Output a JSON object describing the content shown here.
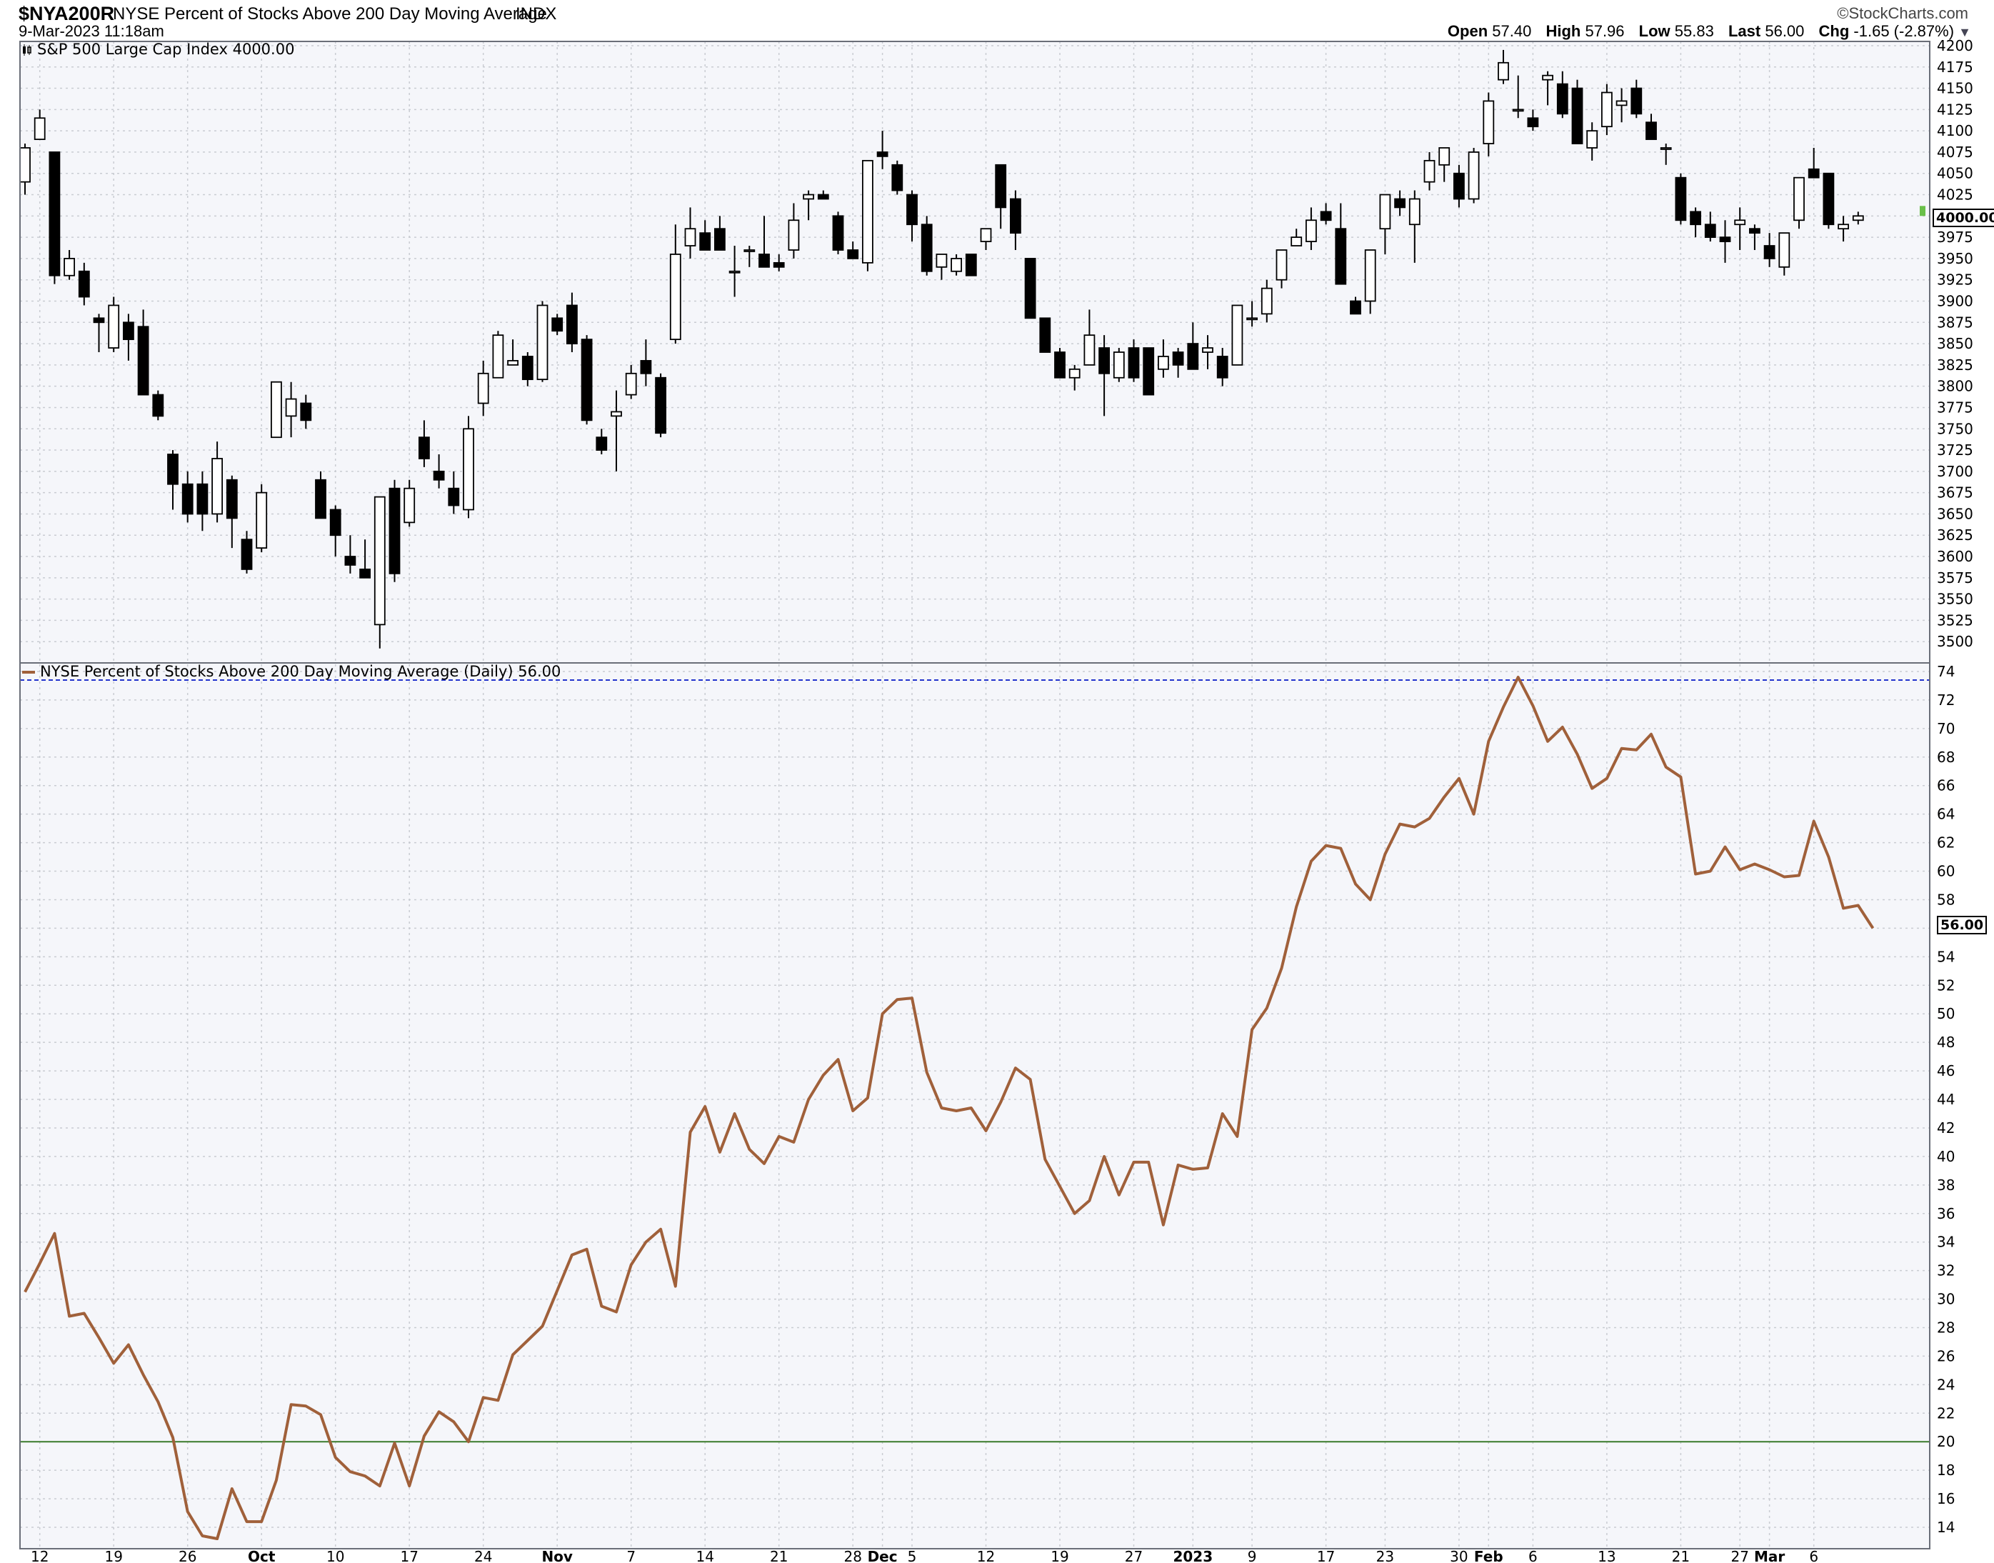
{
  "header": {
    "symbol": "$NYA200R",
    "description": "NYSE Percent of Stocks Above 200 Day Moving Average",
    "exchange": "INDX",
    "date": "9-Mar-2023 11:18am",
    "brand": "©StockCharts.com",
    "stats": [
      {
        "label": "Open",
        "value": "57.40"
      },
      {
        "label": "High",
        "value": "57.96"
      },
      {
        "label": "Low",
        "value": "55.83"
      },
      {
        "label": "Last",
        "value": "56.00"
      },
      {
        "label": "Chg",
        "value": "-1.65 (-2.87%)"
      }
    ],
    "dropdown_icon": "triangle-down-icon"
  },
  "colors": {
    "candle_up": "#ffffff",
    "candle_down": "#000000",
    "line": "#a0603a",
    "reference_line": "#3a7a2a",
    "dashed_line": "#2233cc",
    "grid": "#c9ccd2",
    "background": "#f5f6fa"
  },
  "chart_data": [
    {
      "type": "candlestick",
      "title": "S&P 500 Large Cap Index 4000.00",
      "ylim": [
        3475,
        4205
      ],
      "yticks": [
        3500,
        3525,
        3550,
        3575,
        3600,
        3625,
        3650,
        3675,
        3700,
        3725,
        3750,
        3775,
        3800,
        3825,
        3850,
        3875,
        3900,
        3925,
        3950,
        3975,
        4000,
        4025,
        4050,
        4075,
        4100,
        4125,
        4150,
        4175,
        4200
      ],
      "last_label": "4000.00",
      "ohlc": [
        [
          4040,
          4085,
          4025,
          4080
        ],
        [
          4090,
          4125,
          4090,
          4115
        ],
        [
          4075,
          4075,
          3920,
          3930
        ],
        [
          3930,
          3960,
          3925,
          3950
        ],
        [
          3935,
          3945,
          3895,
          3905
        ],
        [
          3880,
          3885,
          3840,
          3875
        ],
        [
          3845,
          3905,
          3840,
          3895
        ],
        [
          3875,
          3885,
          3830,
          3855
        ],
        [
          3870,
          3890,
          3790,
          3790
        ],
        [
          3790,
          3795,
          3760,
          3765
        ],
        [
          3720,
          3725,
          3655,
          3685
        ],
        [
          3685,
          3700,
          3640,
          3650
        ],
        [
          3685,
          3700,
          3630,
          3650
        ],
        [
          3650,
          3735,
          3640,
          3715
        ],
        [
          3690,
          3695,
          3610,
          3645
        ],
        [
          3620,
          3630,
          3580,
          3585
        ],
        [
          3610,
          3685,
          3605,
          3675
        ],
        [
          3740,
          3800,
          3740,
          3805
        ],
        [
          3765,
          3805,
          3740,
          3785
        ],
        [
          3780,
          3790,
          3750,
          3760
        ],
        [
          3690,
          3700,
          3645,
          3645
        ],
        [
          3655,
          3660,
          3600,
          3625
        ],
        [
          3600,
          3625,
          3580,
          3590
        ],
        [
          3585,
          3620,
          3575,
          3575
        ],
        [
          3520,
          3665,
          3492,
          3670
        ],
        [
          3680,
          3690,
          3570,
          3580
        ],
        [
          3640,
          3690,
          3635,
          3680
        ],
        [
          3740,
          3760,
          3705,
          3715
        ],
        [
          3700,
          3720,
          3680,
          3690
        ],
        [
          3680,
          3700,
          3650,
          3660
        ],
        [
          3655,
          3765,
          3645,
          3750
        ],
        [
          3780,
          3830,
          3765,
          3815
        ],
        [
          3810,
          3865,
          3810,
          3860
        ],
        [
          3825,
          3855,
          3825,
          3830
        ],
        [
          3835,
          3840,
          3800,
          3808
        ],
        [
          3808,
          3900,
          3805,
          3895
        ],
        [
          3880,
          3885,
          3860,
          3865
        ],
        [
          3895,
          3910,
          3840,
          3850
        ],
        [
          3855,
          3860,
          3755,
          3760
        ],
        [
          3740,
          3750,
          3720,
          3725
        ],
        [
          3765,
          3795,
          3700,
          3770
        ],
        [
          3790,
          3825,
          3785,
          3815
        ],
        [
          3830,
          3855,
          3800,
          3815
        ],
        [
          3810,
          3815,
          3740,
          3745
        ],
        [
          3855,
          3990,
          3850,
          3955
        ],
        [
          3965,
          4010,
          3950,
          3985
        ],
        [
          3980,
          3995,
          3960,
          3960
        ],
        [
          3985,
          4000,
          3960,
          3960
        ],
        [
          3935,
          3965,
          3905,
          3935
        ],
        [
          3960,
          3965,
          3940,
          3960
        ],
        [
          3955,
          4000,
          3945,
          3940
        ],
        [
          3945,
          3955,
          3935,
          3940
        ],
        [
          3960,
          4015,
          3950,
          3995
        ],
        [
          4020,
          4030,
          3995,
          4025
        ],
        [
          4025,
          4030,
          4025,
          4020
        ],
        [
          4000,
          4005,
          3955,
          3960
        ],
        [
          3960,
          3970,
          3950,
          3950
        ],
        [
          3945,
          4065,
          3935,
          4065
        ],
        [
          4075,
          4100,
          4055,
          4070
        ],
        [
          4060,
          4065,
          4025,
          4030
        ],
        [
          4025,
          4030,
          3970,
          3990
        ],
        [
          3990,
          4000,
          3930,
          3935
        ],
        [
          3940,
          3945,
          3925,
          3955
        ],
        [
          3935,
          3955,
          3930,
          3950
        ],
        [
          3955,
          3955,
          3930,
          3930
        ],
        [
          3970,
          3980,
          3960,
          3985
        ],
        [
          4060,
          4060,
          3985,
          4010
        ],
        [
          4020,
          4030,
          3960,
          3980
        ],
        [
          3950,
          3950,
          3880,
          3880
        ],
        [
          3880,
          3880,
          3840,
          3840
        ],
        [
          3840,
          3845,
          3810,
          3810
        ],
        [
          3810,
          3825,
          3795,
          3820
        ],
        [
          3825,
          3890,
          3825,
          3860
        ],
        [
          3845,
          3860,
          3765,
          3815
        ],
        [
          3810,
          3845,
          3805,
          3840
        ],
        [
          3845,
          3855,
          3805,
          3810
        ],
        [
          3845,
          3845,
          3790,
          3790
        ],
        [
          3820,
          3855,
          3810,
          3835
        ],
        [
          3840,
          3845,
          3810,
          3825
        ],
        [
          3850,
          3875,
          3835,
          3820
        ],
        [
          3840,
          3860,
          3820,
          3845
        ],
        [
          3835,
          3845,
          3800,
          3810
        ],
        [
          3825,
          3895,
          3825,
          3895
        ],
        [
          3880,
          3900,
          3870,
          3880
        ],
        [
          3885,
          3925,
          3875,
          3915
        ],
        [
          3925,
          3960,
          3915,
          3960
        ],
        [
          3965,
          3985,
          3965,
          3975
        ],
        [
          3970,
          4010,
          3960,
          3995
        ],
        [
          4005,
          4015,
          3990,
          3995
        ],
        [
          3985,
          4015,
          3925,
          3920
        ],
        [
          3900,
          3905,
          3890,
          3885
        ],
        [
          3900,
          3960,
          3885,
          3960
        ],
        [
          3985,
          4020,
          3955,
          4025
        ],
        [
          4020,
          4030,
          4000,
          4010
        ],
        [
          3990,
          4030,
          3945,
          4020
        ],
        [
          4040,
          4075,
          4030,
          4065
        ],
        [
          4060,
          4080,
          4040,
          4080
        ],
        [
          4050,
          4060,
          4010,
          4020
        ],
        [
          4020,
          4080,
          4015,
          4075
        ],
        [
          4085,
          4145,
          4070,
          4135
        ],
        [
          4160,
          4195,
          4155,
          4180
        ],
        [
          4125,
          4165,
          4115,
          4125
        ],
        [
          4115,
          4125,
          4100,
          4105
        ],
        [
          4160,
          4170,
          4130,
          4165
        ],
        [
          4155,
          4170,
          4115,
          4120
        ],
        [
          4150,
          4160,
          4085,
          4085
        ],
        [
          4080,
          4110,
          4065,
          4100
        ],
        [
          4105,
          4155,
          4095,
          4145
        ],
        [
          4130,
          4150,
          4110,
          4135
        ],
        [
          4150,
          4160,
          4115,
          4120
        ],
        [
          4110,
          4120,
          4090,
          4090
        ],
        [
          4080,
          4085,
          4060,
          4080
        ],
        [
          4045,
          4050,
          3990,
          3995
        ],
        [
          4005,
          4010,
          3975,
          3990
        ],
        [
          3990,
          4005,
          3970,
          3975
        ],
        [
          3975,
          3995,
          3945,
          3970
        ],
        [
          3990,
          4010,
          3960,
          3995
        ],
        [
          3985,
          3990,
          3960,
          3980
        ],
        [
          3965,
          3980,
          3940,
          3950
        ],
        [
          3940,
          3980,
          3930,
          3980
        ],
        [
          3995,
          4045,
          3985,
          4045
        ],
        [
          4055,
          4080,
          4045,
          4045
        ],
        [
          4050,
          4050,
          3985,
          3990
        ],
        [
          3985,
          4000,
          3970,
          3990
        ],
        [
          3995,
          4005,
          3990,
          4000
        ]
      ]
    },
    {
      "type": "line",
      "title": "NYSE Percent of Stocks Above 200 Day Moving Average (Daily) 56.00",
      "ylim": [
        12.5,
        74.6
      ],
      "yticks": [
        14,
        16,
        18,
        20,
        22,
        24,
        26,
        28,
        30,
        32,
        34,
        36,
        38,
        40,
        42,
        44,
        46,
        48,
        50,
        52,
        54,
        56,
        58,
        60,
        62,
        64,
        66,
        68,
        70,
        72,
        74
      ],
      "last_label": "56.00",
      "reference_line": 20,
      "dashed_max": 73.4,
      "values": [
        30.5,
        32.5,
        34.6,
        28.8,
        29.0,
        27.3,
        25.5,
        26.8,
        24.7,
        22.8,
        20.3,
        15.1,
        13.4,
        13.2,
        16.7,
        14.4,
        14.4,
        17.3,
        22.6,
        22.5,
        21.9,
        18.9,
        17.9,
        17.6,
        16.9,
        19.9,
        16.9,
        20.4,
        22.1,
        21.4,
        20.0,
        23.1,
        22.9,
        26.1,
        27.1,
        28.1,
        30.6,
        33.1,
        33.5,
        29.5,
        29.1,
        32.4,
        34.0,
        34.9,
        30.9,
        41.7,
        43.5,
        40.3,
        43.0,
        40.5,
        39.5,
        41.4,
        41.0,
        44.0,
        45.7,
        46.8,
        43.2,
        44.1,
        50.0,
        51.0,
        51.1,
        45.9,
        43.4,
        43.2,
        43.4,
        41.8,
        43.8,
        46.2,
        45.4,
        39.8,
        37.9,
        36.0,
        36.9,
        40.0,
        37.3,
        39.6,
        39.6,
        35.2,
        39.4,
        39.1,
        39.2,
        43.0,
        41.4,
        48.9,
        50.4,
        53.2,
        57.5,
        60.7,
        61.8,
        61.6,
        59.1,
        58.0,
        61.2,
        63.3,
        63.1,
        63.7,
        65.2,
        66.5,
        64.0,
        69.1,
        71.5,
        73.6,
        71.6,
        69.1,
        70.1,
        68.2,
        65.8,
        66.5,
        68.6,
        68.5,
        69.6,
        67.3,
        66.6,
        59.8,
        60.0,
        61.7,
        60.1,
        60.5,
        60.1,
        59.6,
        59.7,
        63.5,
        61.0,
        57.4,
        57.6,
        56.0
      ]
    }
  ],
  "x_axis": {
    "labels": [
      {
        "i": 1,
        "text": "12",
        "bold": false
      },
      {
        "i": 6,
        "text": "19",
        "bold": false
      },
      {
        "i": 11,
        "text": "26",
        "bold": false
      },
      {
        "i": 16,
        "text": "Oct",
        "bold": true
      },
      {
        "i": 21,
        "text": "10",
        "bold": false
      },
      {
        "i": 26,
        "text": "17",
        "bold": false
      },
      {
        "i": 31,
        "text": "24",
        "bold": false
      },
      {
        "i": 36,
        "text": "Nov",
        "bold": true
      },
      {
        "i": 41,
        "text": "7",
        "bold": false
      },
      {
        "i": 46,
        "text": "14",
        "bold": false
      },
      {
        "i": 51,
        "text": "21",
        "bold": false
      },
      {
        "i": 56,
        "text": "28",
        "bold": false
      },
      {
        "i": 58,
        "text": "Dec",
        "bold": true
      },
      {
        "i": 60,
        "text": "5",
        "bold": false
      },
      {
        "i": 65,
        "text": "12",
        "bold": false
      },
      {
        "i": 70,
        "text": "19",
        "bold": false
      },
      {
        "i": 75,
        "text": "27",
        "bold": false
      },
      {
        "i": 79,
        "text": "2023",
        "bold": true
      },
      {
        "i": 83,
        "text": "9",
        "bold": false
      },
      {
        "i": 88,
        "text": "17",
        "bold": false
      },
      {
        "i": 92,
        "text": "23",
        "bold": false
      },
      {
        "i": 97,
        "text": "30",
        "bold": false
      },
      {
        "i": 99,
        "text": "Feb",
        "bold": true
      },
      {
        "i": 102,
        "text": "6",
        "bold": false
      },
      {
        "i": 107,
        "text": "13",
        "bold": false
      },
      {
        "i": 112,
        "text": "21",
        "bold": false
      },
      {
        "i": 116,
        "text": "27",
        "bold": false
      },
      {
        "i": 118,
        "text": "Mar",
        "bold": true
      },
      {
        "i": 121,
        "text": "6",
        "bold": false
      }
    ]
  }
}
